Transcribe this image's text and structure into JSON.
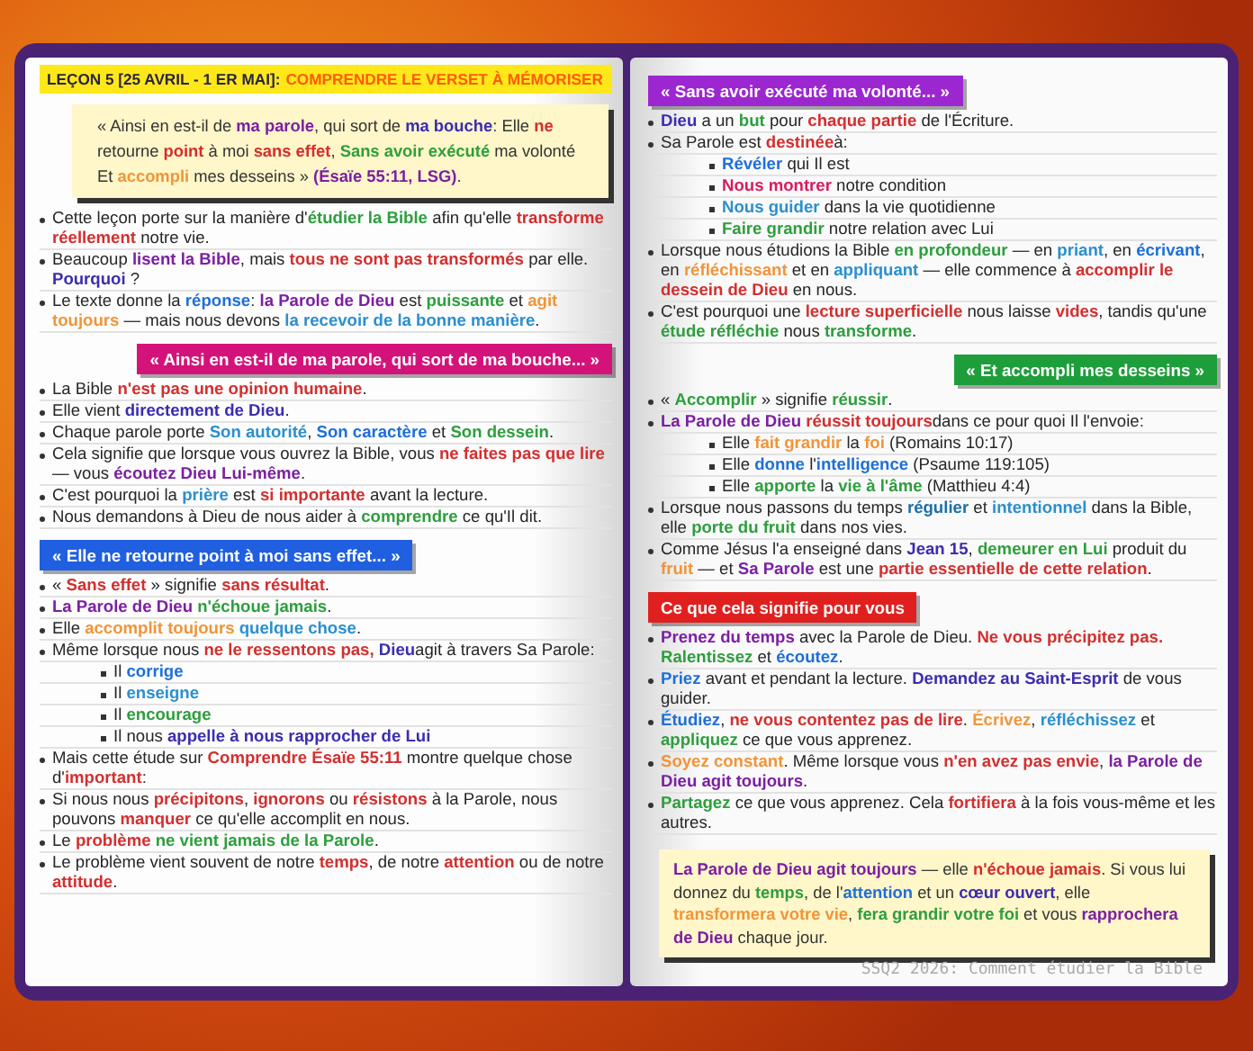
{
  "left_page": {
    "header": {
      "lesson": "LEÇON 5 [25 AVRIL - 1 ER MAI]:",
      "title": "COMPRENDRE LE VERSET À MÉMORISER"
    },
    "memory_verse": [
      "« Ainsi en est-il de ",
      {
        "text": "ma parole",
        "color": "#7b1fa2"
      },
      ", qui sort de ",
      {
        "text": "ma bouche",
        "color": "#3b2db0"
      },
      ": Elle ",
      {
        "text": "ne",
        "color": "#d32f2f"
      },
      " retourne ",
      {
        "text": "point",
        "color": "#d32f2f"
      },
      " à moi ",
      {
        "text": "sans effet",
        "color": "#d32f2f"
      },
      ", ",
      {
        "text": "Sans avoir exécuté",
        "color": "#2e9e3e"
      },
      " ma volonté Et ",
      {
        "text": "accompli",
        "color": "#f0953a"
      },
      " mes desseins » ",
      {
        "text": "(Ésaïe 55:11, LSG)",
        "color": "#7b1fa2"
      },
      "."
    ],
    "intro_bullets": [
      {
        "segments": [
          "Cette leçon porte sur la manière d'",
          {
            "text": "étudier la Bible",
            "color": "#2e9e3e"
          },
          " afin qu'elle ",
          {
            "text": "transforme réellement",
            "color": "#d32f2f"
          },
          " notre vie."
        ]
      },
      {
        "segments": [
          "Beaucoup ",
          {
            "text": "lisent la Bible",
            "color": "#7b1fa2"
          },
          ", mais ",
          {
            "text": "tous ne sont pas transformés",
            "color": "#d32f2f"
          },
          " par elle. ",
          {
            "text": "Pourquoi",
            "color": "#3b2db0"
          },
          " ?"
        ]
      },
      {
        "segments": [
          "Le texte donne la ",
          {
            "text": "réponse",
            "color": "#1e6fd9"
          },
          ": ",
          {
            "text": "la Parole de Dieu",
            "color": "#7b1fa2"
          },
          " est ",
          {
            "text": "puissante",
            "color": "#2e9e3e"
          },
          " et ",
          {
            "text": "agit toujours",
            "color": "#f0953a"
          },
          " — mais nous devons ",
          {
            "text": "la recevoir de la bonne manière",
            "color": "#2b8fcf"
          },
          "."
        ]
      }
    ],
    "sections": [
      {
        "heading": "« Ainsi en est-il de ma parole, qui sort de ma bouche... »",
        "color": "#d4137a",
        "bullets": [
          {
            "segments": [
              "La Bible ",
              {
                "text": "n'est pas une opinion humaine",
                "color": "#d32f2f"
              },
              "."
            ]
          },
          {
            "segments": [
              "Elle vient ",
              {
                "text": "directement de Dieu",
                "color": "#3b2db0"
              },
              "."
            ]
          },
          {
            "segments": [
              "Chaque parole porte ",
              {
                "text": "Son autorité",
                "color": "#2b8fcf"
              },
              ", ",
              {
                "text": "Son caractère",
                "color": "#1e6fd9"
              },
              " et ",
              {
                "text": "Son dessein",
                "color": "#2e9e3e"
              },
              "."
            ]
          },
          {
            "segments": [
              "Cela signifie que lorsque vous ouvrez la Bible, vous ",
              {
                "text": "ne faites pas que lire",
                "color": "#d32f2f"
              },
              " — vous ",
              {
                "text": "écoutez Dieu Lui-même",
                "color": "#7b1fa2"
              },
              "."
            ]
          },
          {
            "segments": [
              "C'est pourquoi la ",
              {
                "text": "prière",
                "color": "#2b8fcf"
              },
              " est ",
              {
                "text": "si importante",
                "color": "#d32f2f"
              },
              " avant la lecture."
            ]
          },
          {
            "segments": [
              "Nous demandons à Dieu de nous aider à ",
              {
                "text": "comprendre",
                "color": "#2e9e3e"
              },
              " ce qu'Il dit."
            ]
          }
        ]
      },
      {
        "heading": "« Elle ne retourne point à moi sans effet... »",
        "color": "#1f5fe0",
        "bullets": [
          {
            "segments": [
              "« ",
              {
                "text": "Sans effet",
                "color": "#d32f2f"
              },
              " » signifie ",
              {
                "text": "sans résultat",
                "color": "#d32f2f"
              },
              "."
            ]
          },
          {
            "segments": [
              {
                "text": "La Parole de Dieu ",
                "color": "#7b1fa2"
              },
              {
                "text": "n'échoue jamais",
                "color": "#2e9e3e"
              },
              "."
            ]
          },
          {
            "segments": [
              "Elle ",
              {
                "text": "accomplit toujours ",
                "color": "#f0953a"
              },
              {
                "text": "quelque chose",
                "color": "#2b8fcf"
              },
              "."
            ]
          },
          {
            "segments": [
              "Même lorsque nous ",
              {
                "text": "ne le ressentons pas, ",
                "color": "#d32f2f"
              },
              {
                "text": "Dieu",
                "color": "#3b2db0"
              },
              "agit à travers Sa Parole:"
            ],
            "children": [
              {
                "segments": [
                  "Il ",
                  {
                    "text": "corrige",
                    "color": "#1e6fd9"
                  }
                ]
              },
              {
                "segments": [
                  "Il ",
                  {
                    "text": "enseigne",
                    "color": "#2b8fcf"
                  }
                ]
              },
              {
                "segments": [
                  "Il ",
                  {
                    "text": "encourage",
                    "color": "#2e9e3e"
                  }
                ]
              },
              {
                "segments": [
                  "Il nous ",
                  {
                    "text": "appelle à nous rapprocher de Lui",
                    "color": "#3b2db0"
                  }
                ]
              }
            ]
          },
          {
            "segments": [
              "Mais cette étude sur ",
              {
                "text": "Comprendre Ésaïe 55:11",
                "color": "#d32f2f"
              },
              " montre quelque chose d'",
              {
                "text": "important",
                "color": "#d32f2f"
              },
              ":"
            ]
          },
          {
            "segments": [
              "Si nous nous ",
              {
                "text": "précipitons",
                "color": "#d32f2f"
              },
              ", ",
              {
                "text": "ignorons",
                "color": "#d32f2f"
              },
              " ou ",
              {
                "text": "résistons",
                "color": "#d32f2f"
              },
              " à la Parole, nous pouvons ",
              {
                "text": "manquer",
                "color": "#d32f2f"
              },
              " ce qu'elle accomplit en nous."
            ]
          },
          {
            "segments": [
              "Le ",
              {
                "text": "problème ",
                "color": "#d32f2f"
              },
              {
                "text": "ne vient jamais de la Parole",
                "color": "#2e9e3e"
              },
              "."
            ]
          },
          {
            "segments": [
              "Le problème vient souvent de notre ",
              {
                "text": "temps",
                "color": "#d32f2f"
              },
              ", de notre ",
              {
                "text": "attention",
                "color": "#d32f2f"
              },
              " ou de notre ",
              {
                "text": "attitude",
                "color": "#d32f2f"
              },
              "."
            ]
          }
        ]
      }
    ]
  },
  "right_page": {
    "sections": [
      {
        "heading": "« Sans avoir exécuté ma volonté... »",
        "color": "#9c27d0",
        "bullets": [
          {
            "segments": [
              {
                "text": "Dieu",
                "color": "#3b2db0"
              },
              " a un ",
              {
                "text": "but",
                "color": "#2e9e3e"
              },
              " pour ",
              {
                "text": "chaque partie",
                "color": "#d32f2f"
              },
              " de l'Écriture."
            ]
          },
          {
            "segments": [
              "Sa Parole est ",
              {
                "text": "destinée",
                "color": "#d32f2f"
              },
              "à:"
            ],
            "children": [
              {
                "segments": [
                  {
                    "text": "Révéler",
                    "color": "#1e6fd9"
                  },
                  " qui Il est"
                ]
              },
              {
                "segments": [
                  {
                    "text": "Nous montrer",
                    "color": "#d81b60"
                  },
                  " notre condition"
                ]
              },
              {
                "segments": [
                  {
                    "text": "Nous guider",
                    "color": "#2b8fcf"
                  },
                  " dans la vie quotidienne"
                ]
              },
              {
                "segments": [
                  {
                    "text": "Faire grandir",
                    "color": "#2e9e3e"
                  },
                  " notre relation avec Lui"
                ]
              }
            ]
          },
          {
            "segments": [
              "Lorsque nous étudions la Bible ",
              {
                "text": "en profondeur",
                "color": "#2e9e3e"
              },
              " — en ",
              {
                "text": "priant",
                "color": "#2b8fcf"
              },
              ", en ",
              {
                "text": "écrivant",
                "color": "#1e6fd9"
              },
              ", en ",
              {
                "text": "réfléchissant",
                "color": "#f0953a"
              },
              " et en ",
              {
                "text": "appliquant",
                "color": "#2b8fcf"
              },
              " — elle commence à ",
              {
                "text": "accomplir le dessein de Dieu",
                "color": "#d32f2f"
              },
              " en nous."
            ]
          },
          {
            "segments": [
              "C'est pourquoi une ",
              {
                "text": "lecture superficielle",
                "color": "#d32f2f"
              },
              " nous laisse ",
              {
                "text": "vides",
                "color": "#d32f2f"
              },
              ", tandis qu'une ",
              {
                "text": "étude réfléchie",
                "color": "#2e9e3e"
              },
              " nous ",
              {
                "text": "transforme",
                "color": "#2e9e3e"
              },
              "."
            ]
          }
        ]
      },
      {
        "heading": "« Et accompli mes desseins »",
        "color": "#1e9e3a",
        "bullets": [
          {
            "segments": [
              "« ",
              {
                "text": "Accomplir",
                "color": "#2e9e3e"
              },
              " » signifie ",
              {
                "text": "réussir",
                "color": "#2e9e3e"
              },
              "."
            ]
          },
          {
            "segments": [
              {
                "text": "La Parole de Dieu ",
                "color": "#7b1fa2"
              },
              {
                "text": "réussit toujours",
                "color": "#d32f2f"
              },
              "dans ce pour quoi Il l'envoie:"
            ],
            "children": [
              {
                "segments": [
                  "Elle ",
                  {
                    "text": "fait grandir",
                    "color": "#f0953a"
                  },
                  " la ",
                  {
                    "text": "foi",
                    "color": "#f0953a"
                  },
                  " (Romains 10:17)"
                ]
              },
              {
                "segments": [
                  "Elle ",
                  {
                    "text": "donne",
                    "color": "#1e6fd9"
                  },
                  " l'",
                  {
                    "text": "intelligence",
                    "color": "#1e6fd9"
                  },
                  " (Psaume 119:105)"
                ]
              },
              {
                "segments": [
                  "Elle ",
                  {
                    "text": "apporte",
                    "color": "#2e9e3e"
                  },
                  " la ",
                  {
                    "text": "vie à l'âme",
                    "color": "#2e9e3e"
                  },
                  " (Matthieu 4:4)"
                ]
              }
            ]
          },
          {
            "segments": [
              "Lorsque nous passons du temps ",
              {
                "text": "régulier",
                "color": "#1d6fa5"
              },
              " et ",
              {
                "text": "intentionnel",
                "color": "#2b8fcf"
              },
              " dans la Bible, elle ",
              {
                "text": "porte du fruit",
                "color": "#2e9e3e"
              },
              " dans nos vies."
            ]
          },
          {
            "segments": [
              "Comme Jésus l'a enseigné dans ",
              {
                "text": "Jean 15",
                "color": "#3b2db0"
              },
              ", ",
              {
                "text": "demeurer en Lui",
                "color": "#2e9e3e"
              },
              " produit du ",
              {
                "text": "fruit",
                "color": "#f0953a"
              },
              " — et ",
              {
                "text": "Sa Parole",
                "color": "#7b1fa2"
              },
              " est une ",
              {
                "text": "partie essentielle de cette relation",
                "color": "#d32f2f"
              },
              "."
            ]
          }
        ]
      },
      {
        "heading": "Ce que cela signifie pour vous",
        "color": "#e0201f",
        "bullets": [
          {
            "segments": [
              {
                "text": "Prenez du temps",
                "color": "#7b1fa2"
              },
              " avec la Parole de Dieu. ",
              {
                "text": "Ne vous précipitez pas. ",
                "color": "#d32f2f"
              },
              {
                "text": "Ralentissez",
                "color": "#2e9e3e"
              },
              " et ",
              {
                "text": "écoutez",
                "color": "#1e6fd9"
              },
              "."
            ]
          },
          {
            "segments": [
              {
                "text": "Priez",
                "color": "#1e6fd9"
              },
              " avant et pendant la lecture. ",
              {
                "text": "Demandez au Saint-Esprit",
                "color": "#3b2db0"
              },
              " de vous guider."
            ]
          },
          {
            "segments": [
              {
                "text": "Étudiez",
                "color": "#1e6fd9"
              },
              ", ",
              {
                "text": "ne vous contentez pas de lire",
                "color": "#d32f2f"
              },
              ". ",
              {
                "text": "Écrivez",
                "color": "#f0953a"
              },
              ", ",
              {
                "text": "réfléchissez",
                "color": "#2b8fcf"
              },
              " et ",
              {
                "text": "appliquez",
                "color": "#2e9e3e"
              },
              " ce que vous apprenez."
            ]
          },
          {
            "segments": [
              {
                "text": "Soyez constant",
                "color": "#f0953a"
              },
              ". Même lorsque vous ",
              {
                "text": "n'en avez pas envie",
                "color": "#d32f2f"
              },
              ", ",
              {
                "text": "la Parole de Dieu agit toujours",
                "color": "#7b1fa2"
              },
              "."
            ]
          },
          {
            "segments": [
              {
                "text": "Partagez",
                "color": "#2e9e3e"
              },
              " ce que vous apprenez. Cela ",
              {
                "text": "fortifiera",
                "color": "#d32f2f"
              },
              " à la fois vous-même et les autres."
            ]
          }
        ]
      }
    ],
    "conclusion": [
      {
        "text": "La Parole de Dieu agit toujours",
        "color": "#7b1fa2"
      },
      " — elle ",
      {
        "text": "n'échoue jamais",
        "color": "#d32f2f"
      },
      ". Si vous lui donnez du ",
      {
        "text": "temps",
        "color": "#2e9e3e"
      },
      ", de l'",
      {
        "text": "attention",
        "color": "#1e6fd9"
      },
      " et un ",
      {
        "text": "cœur ouvert",
        "color": "#3b2db0"
      },
      ", elle ",
      {
        "text": "transformera votre vie",
        "color": "#f0953a"
      },
      ", ",
      {
        "text": "fera grandir votre foi",
        "color": "#2e9e3e"
      },
      " et vous ",
      {
        "text": "rapprochera de Dieu",
        "color": "#7b1fa2"
      },
      " chaque jour."
    ],
    "footer": "SSQ2 2026: Comment étudier la Bible"
  }
}
